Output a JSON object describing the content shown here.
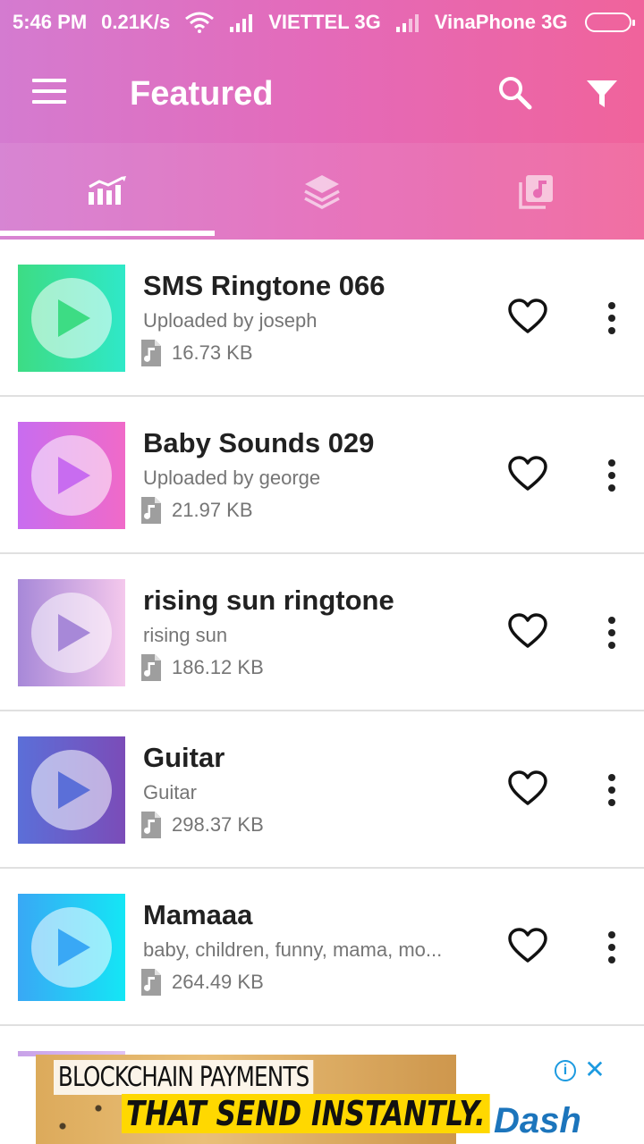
{
  "status_bar": {
    "time": "5:46 PM",
    "speed": "0.21K/s",
    "carrier1": "VIETTEL 3G",
    "carrier2": "VinaPhone 3G"
  },
  "app_bar": {
    "title": "Featured",
    "icons": [
      "menu-icon",
      "search-icon",
      "filter-icon"
    ]
  },
  "tabs": [
    {
      "icon": "trending-chart-icon",
      "selected": true
    },
    {
      "icon": "layers-icon",
      "selected": false
    },
    {
      "icon": "music-library-icon",
      "selected": false
    }
  ],
  "ringtones": [
    {
      "title": "SMS Ringtone 066",
      "subtitle": "Uploaded by joseph",
      "size": "16.73 KB",
      "colors": [
        "#3ddc84",
        "#2fe8c8"
      ]
    },
    {
      "title": "Baby Sounds 029",
      "subtitle": "Uploaded by george",
      "size": "21.97 KB",
      "colors": [
        "#c86cf0",
        "#f06ac8"
      ]
    },
    {
      "title": "rising sun ringtone",
      "subtitle": "rising sun",
      "size": "186.12 KB",
      "colors": [
        "#a788d8",
        "#f4c8ec"
      ]
    },
    {
      "title": "Guitar",
      "subtitle": "Guitar",
      "size": "298.37 KB",
      "colors": [
        "#5b6fd8",
        "#7b4cb8"
      ]
    },
    {
      "title": "Mamaaa",
      "subtitle": "baby, children, funny, mama, mo...",
      "size": "264.49 KB",
      "colors": [
        "#39a8f5",
        "#14e6f5"
      ]
    }
  ],
  "ad": {
    "line1": "BLOCKCHAIN PAYMENTS",
    "line2": "THAT SEND INSTANTLY.",
    "brand": "Dash",
    "info_glyph": "i",
    "close_glyph": "✕"
  }
}
